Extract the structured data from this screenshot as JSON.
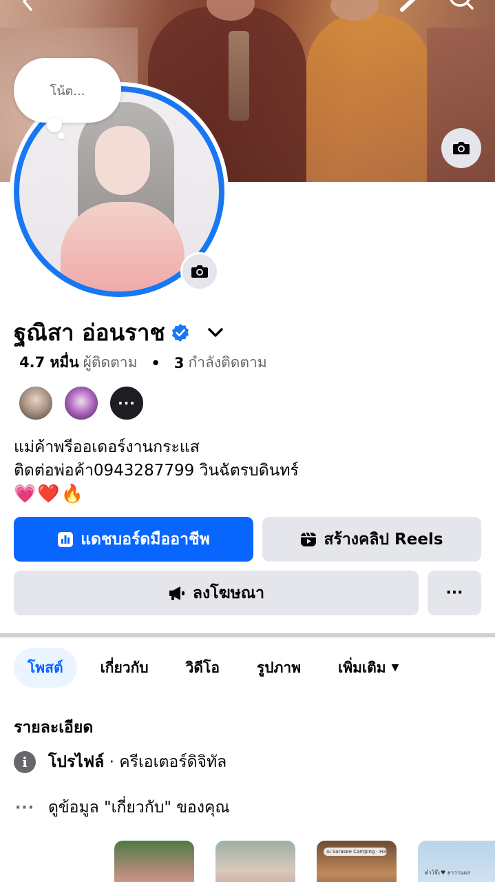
{
  "note": {
    "placeholder": "โน้ต..."
  },
  "profile": {
    "name": "ฐณิสา อ่อนราช",
    "followers_count": "4.7 หมื่น",
    "followers_label": "ผู้ติดตาม",
    "following_count": "3",
    "following_label": "กำลังติดตาม",
    "friends_more": "···",
    "bio_line1": "แม่ค้าพรีออเดอร์งานกระแส",
    "bio_line2": "ติดต่อพ่อค้า0943287799 วินฉัตรบดินทร์",
    "bio_line3": "💗❤️🔥"
  },
  "buttons": {
    "dashboard": "แดชบอร์ดมืออาชีพ",
    "reels": "สร้างคลิป Reels",
    "ads": "ลงโฆษณา",
    "more": "···"
  },
  "tabs": [
    {
      "label": "โพสต์"
    },
    {
      "label": "เกี่ยวกับ"
    },
    {
      "label": "วิดีโอ"
    },
    {
      "label": "รูปภาพ"
    },
    {
      "label": "เพิ่มเติม"
    }
  ],
  "details": {
    "title": "รายละเอียด",
    "profile_label": "โปรไฟล์",
    "profile_value": " · ครีเอเตอร์ดิจิทัล",
    "about_text": "ดูข้อมูล \"เกี่ยวกับ\" ของคุณ"
  },
  "thumbnails": {
    "t3_tag": "ณ Sarasee Camping · Hat Wangsotthong",
    "t4_text": "ตำโจ๊ะ♥ ลาวานแก"
  },
  "colors": {
    "accent": "#0866ff",
    "verified": "#1877f2",
    "secondary_text": "#65676b",
    "button_gray": "#e4e6eb"
  },
  "icons": {
    "back": "chevron-left-icon",
    "edit": "pencil-icon",
    "search": "search-icon",
    "camera": "camera-icon",
    "verified": "verified-badge-icon",
    "dropdown": "chevron-down-icon",
    "dashboard": "bar-chart-icon",
    "reels": "reels-icon",
    "ads": "megaphone-icon",
    "info": "info-icon",
    "more": "ellipsis-icon"
  }
}
